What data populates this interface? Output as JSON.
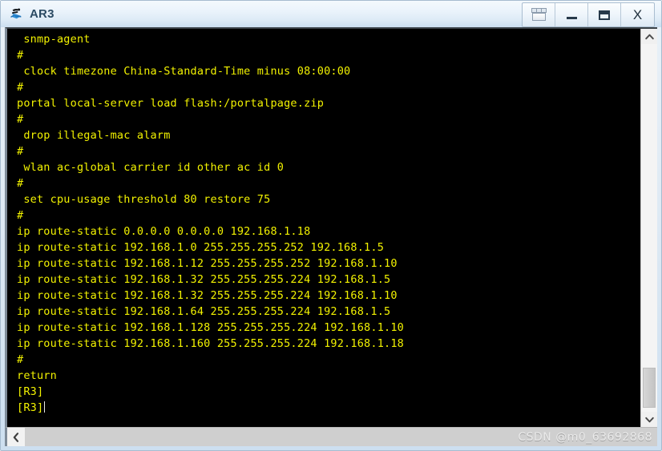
{
  "window": {
    "title": "AR3",
    "app_icon": "router-icon",
    "controls": [
      {
        "name": "window-list-button",
        "icon": "tile-windows-icon",
        "label": ""
      },
      {
        "name": "minimize-button",
        "icon": "minimize-icon",
        "label": ""
      },
      {
        "name": "maximize-button",
        "icon": "maximize-icon",
        "label": ""
      },
      {
        "name": "close-button",
        "icon": "close-icon",
        "label": "X"
      }
    ]
  },
  "terminal": {
    "background_color": "#000000",
    "text_color": "#f2f200",
    "cursor_visible": true,
    "lines": [
      " snmp-agent",
      "#",
      " clock timezone China-Standard-Time minus 08:00:00",
      "#",
      "portal local-server load flash:/portalpage.zip",
      "#",
      " drop illegal-mac alarm",
      "#",
      " wlan ac-global carrier id other ac id 0",
      "#",
      " set cpu-usage threshold 80 restore 75",
      "#",
      "ip route-static 0.0.0.0 0.0.0.0 192.168.1.18",
      "ip route-static 192.168.1.0 255.255.255.252 192.168.1.5",
      "ip route-static 192.168.1.12 255.255.255.252 192.168.1.10",
      "ip route-static 192.168.1.32 255.255.255.224 192.168.1.5",
      "ip route-static 192.168.1.32 255.255.255.224 192.168.1.10",
      "ip route-static 192.168.1.64 255.255.255.224 192.168.1.5",
      "ip route-static 192.168.1.128 255.255.255.224 192.168.1.10",
      "ip route-static 192.168.1.160 255.255.255.224 192.168.1.18",
      "#",
      "return",
      "[R3]"
    ],
    "prompt_line": "[R3]"
  },
  "scrollbars": {
    "vertical": {
      "up_arrow": "⌃",
      "down_arrow": "⌄",
      "thumb_top_pct": 88,
      "thumb_height_pct": 11
    },
    "horizontal": {
      "left_arrow": "‹",
      "right_arrow": ""
    }
  },
  "watermark": {
    "text": "CSDN @m0_63692868"
  }
}
